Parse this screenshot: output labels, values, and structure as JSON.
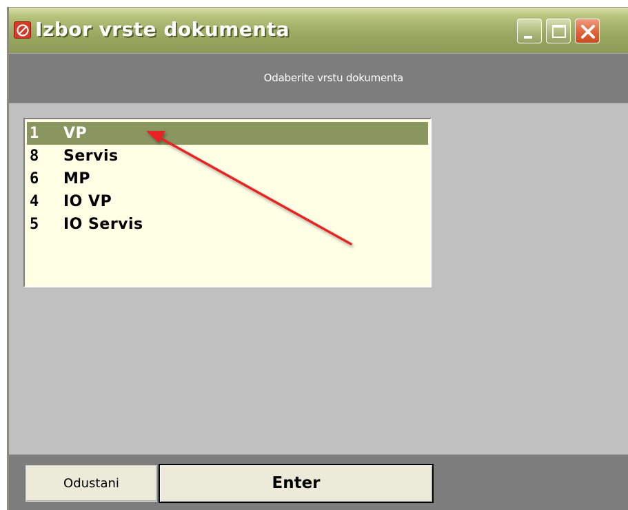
{
  "window": {
    "title": "Izbor vrste dokumenta",
    "title_bar_color": "#96a45d",
    "icon": "app-logo-icon"
  },
  "header": {
    "subtitle": "Odaberite vrstu dokumenta"
  },
  "list": {
    "selected_color": "#8a9660",
    "background": "#ffffe6",
    "items": [
      {
        "code": "1",
        "name": "VP",
        "selected": true
      },
      {
        "code": "8",
        "name": "Servis",
        "selected": false
      },
      {
        "code": "6",
        "name": "MP",
        "selected": false
      },
      {
        "code": "4",
        "name": "IO VP",
        "selected": false
      },
      {
        "code": "5",
        "name": "IO Servis",
        "selected": false
      }
    ]
  },
  "buttons": {
    "cancel_label": "Odustani",
    "enter_label": "Enter"
  },
  "annotation": {
    "arrow_color": "#e82020",
    "arrow_target": "list-item-1-VP"
  }
}
